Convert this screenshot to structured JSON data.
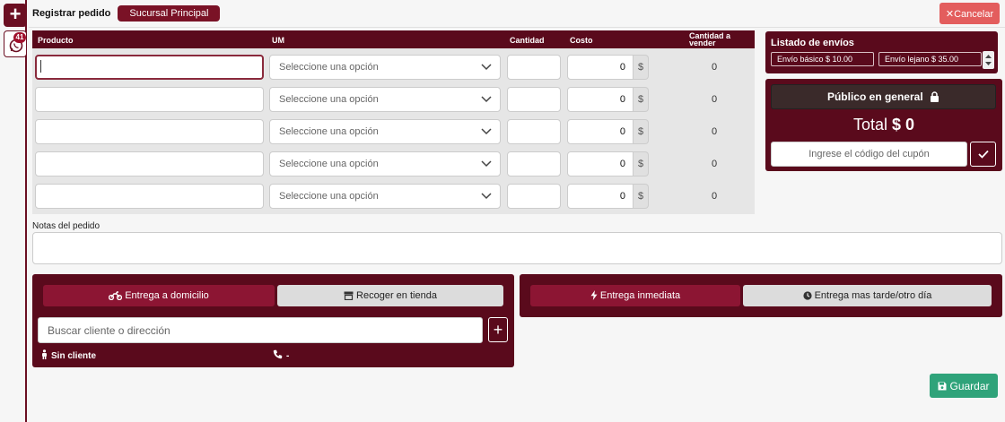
{
  "rail": {
    "badge_count": "41"
  },
  "header": {
    "title": "Registrar pedido",
    "branch": "Sucursal Principal",
    "cancel_label": "Cancelar"
  },
  "products": {
    "columns": {
      "product": "Producto",
      "um": "UM",
      "quantity": "Cantidad",
      "cost": "Costo",
      "qty_to_sell": "Cantidad a vender"
    },
    "rows": [
      {
        "product": "",
        "um_placeholder": "Seleccione una opción",
        "quantity": "",
        "cost": "0",
        "currency": "$",
        "qty_to_sell": "0"
      },
      {
        "product": "",
        "um_placeholder": "Seleccione una opción",
        "quantity": "",
        "cost": "0",
        "currency": "$",
        "qty_to_sell": "0"
      },
      {
        "product": "",
        "um_placeholder": "Seleccione una opción",
        "quantity": "",
        "cost": "0",
        "currency": "$",
        "qty_to_sell": "0"
      },
      {
        "product": "",
        "um_placeholder": "Seleccione una opción",
        "quantity": "",
        "cost": "0",
        "currency": "$",
        "qty_to_sell": "0"
      },
      {
        "product": "",
        "um_placeholder": "Seleccione una opción",
        "quantity": "",
        "cost": "0",
        "currency": "$",
        "qty_to_sell": "0"
      }
    ]
  },
  "shipping": {
    "title": "Listado de envíos",
    "options": [
      {
        "label": "Envío básico  $ 10.00"
      },
      {
        "label": "Envío lejano  $ 35.00"
      }
    ]
  },
  "customer": {
    "button_label": "Público en general",
    "total_label": "Total",
    "total_value": "$ 0",
    "coupon_placeholder": "Ingrese el código del cupón"
  },
  "notes": {
    "label": "Notas del pedido",
    "value": ""
  },
  "delivery": {
    "tab_home": "Entrega a domicilio",
    "tab_pickup": "Recoger en tienda",
    "search_placeholder": "Buscar cliente o dirección",
    "client_label": "Sin cliente",
    "phone_label": "-"
  },
  "timing": {
    "tab_now": "Entrega inmediata",
    "tab_later": "Entrega mas tarde/otro día"
  },
  "save_label": "Guardar",
  "colors": {
    "primary": "#5a0a1c",
    "accent": "#8c1533",
    "cancel": "#e35d5d",
    "save": "#2fa37a"
  }
}
